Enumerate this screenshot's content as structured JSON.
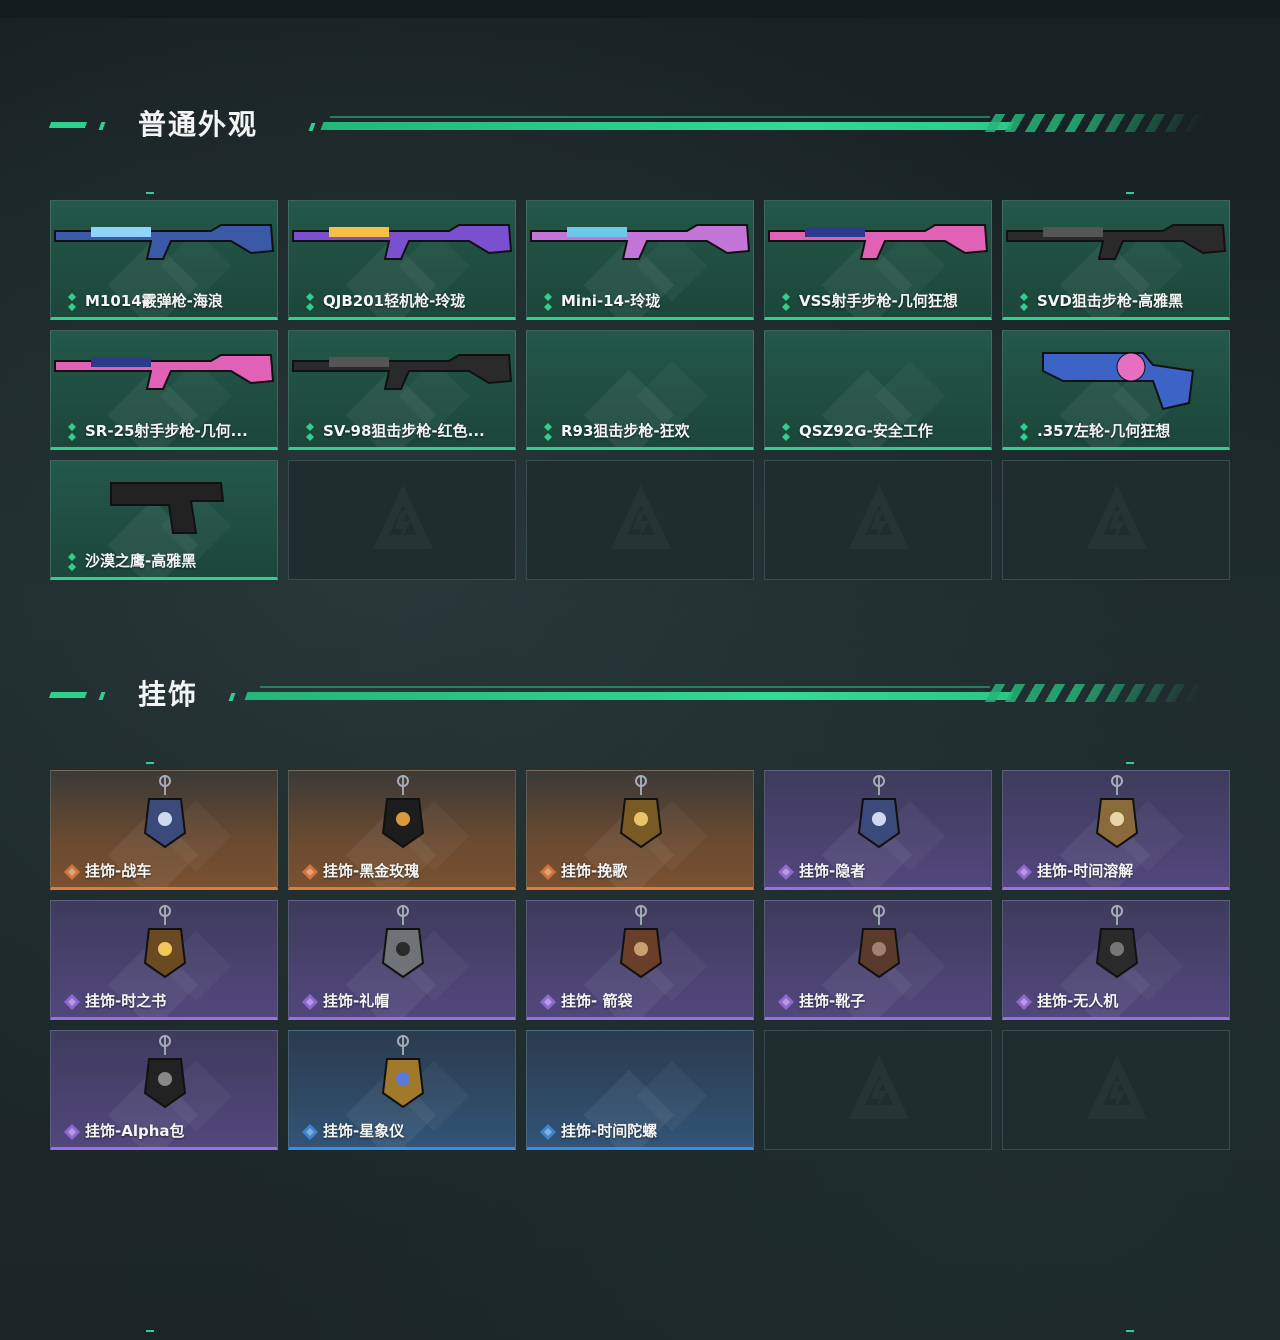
{
  "sections": {
    "skins": {
      "title": "普通外观",
      "items": [
        {
          "label": "M1014霰弹枪-海浪",
          "rarity": "green",
          "icon": "shotgun-icon"
        },
        {
          "label": "QJB201轻机枪-玲珑",
          "rarity": "green",
          "icon": "machine-gun-icon"
        },
        {
          "label": "Mini-14-玲珑",
          "rarity": "green",
          "icon": "rifle-icon"
        },
        {
          "label": "VSS射手步枪-几何狂想",
          "rarity": "green",
          "icon": "marksman-rifle-icon"
        },
        {
          "label": "SVD狙击步枪-高雅黑",
          "rarity": "green",
          "icon": "sniper-rifle-icon"
        },
        {
          "label": "SR-25射手步枪-几何...",
          "rarity": "green",
          "icon": "marksman-rifle-icon"
        },
        {
          "label": "SV-98狙击步枪-红色...",
          "rarity": "green",
          "icon": "sniper-rifle-icon"
        },
        {
          "label": "R93狙击步枪-狂欢",
          "rarity": "green",
          "icon": "none"
        },
        {
          "label": "QSZ92G-安全工作",
          "rarity": "green",
          "icon": "none"
        },
        {
          "label": ".357左轮-几何狂想",
          "rarity": "green",
          "icon": "revolver-icon"
        },
        {
          "label": "沙漠之鹰-高雅黑",
          "rarity": "green",
          "icon": "pistol-icon"
        }
      ],
      "empty_slots": 4
    },
    "charms": {
      "title": "挂饰",
      "items": [
        {
          "label": "挂饰-战车",
          "rarity": "orange",
          "icon": "tarot-card-charm-icon"
        },
        {
          "label": "挂饰-黑金玫瑰",
          "rarity": "orange",
          "icon": "rose-charm-icon"
        },
        {
          "label": "挂饰-挽歌",
          "rarity": "orange",
          "icon": "pendant-charm-icon"
        },
        {
          "label": "挂饰-隐者",
          "rarity": "purple",
          "icon": "tarot-card-charm-icon"
        },
        {
          "label": "挂饰-时间溶解",
          "rarity": "purple",
          "icon": "melting-clock-charm-icon"
        },
        {
          "label": "挂饰-时之书",
          "rarity": "purple",
          "icon": "book-charm-icon"
        },
        {
          "label": "挂饰-礼帽",
          "rarity": "purple",
          "icon": "hat-charm-icon"
        },
        {
          "label": "挂饰- 箭袋",
          "rarity": "purple",
          "icon": "quiver-charm-icon"
        },
        {
          "label": "挂饰-靴子",
          "rarity": "purple",
          "icon": "boot-charm-icon"
        },
        {
          "label": "挂饰-无人机",
          "rarity": "purple",
          "icon": "drone-charm-icon"
        },
        {
          "label": "挂饰-Alpha包",
          "rarity": "purple",
          "icon": "bag-charm-icon"
        },
        {
          "label": "挂饰-星象仪",
          "rarity": "blue",
          "icon": "astrolabe-charm-icon"
        },
        {
          "label": "挂饰-时间陀螺",
          "rarity": "blue",
          "icon": "none"
        }
      ],
      "empty_slots": 2
    }
  },
  "colors": {
    "accent": "#2fd08e",
    "green": "#2fcf8d",
    "orange": "#e07d3c",
    "purple": "#9a6fe0",
    "blue": "#3f8ede"
  }
}
